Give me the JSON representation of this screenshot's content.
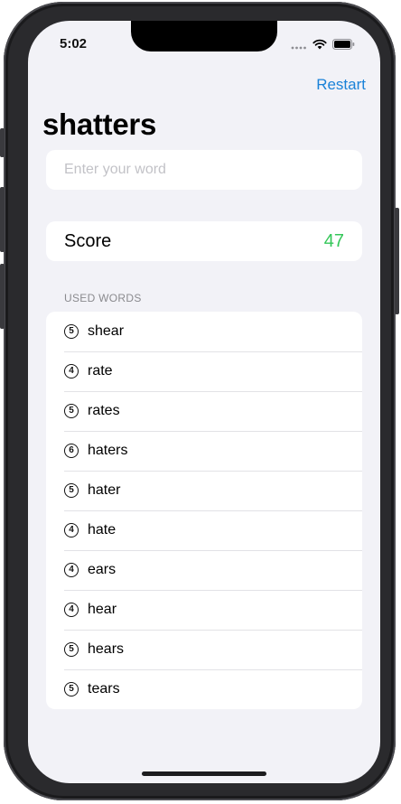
{
  "status_bar": {
    "time": "5:02"
  },
  "nav": {
    "restart_label": "Restart",
    "title": "shatters"
  },
  "input": {
    "placeholder": "Enter your word",
    "value": ""
  },
  "score": {
    "label": "Score",
    "value": "47"
  },
  "used_words": {
    "header": "USED WORDS",
    "items": [
      {
        "count": "5",
        "word": "shear"
      },
      {
        "count": "4",
        "word": "rate"
      },
      {
        "count": "5",
        "word": "rates"
      },
      {
        "count": "6",
        "word": "haters"
      },
      {
        "count": "5",
        "word": "hater"
      },
      {
        "count": "4",
        "word": "hate"
      },
      {
        "count": "4",
        "word": "ears"
      },
      {
        "count": "4",
        "word": "hear"
      },
      {
        "count": "5",
        "word": "hears"
      },
      {
        "count": "5",
        "word": "tears"
      }
    ]
  },
  "colors": {
    "accent": "#1a82d8",
    "score": "#34c759",
    "background": "#f2f2f7"
  },
  "icons": {
    "signal": "cellular-signal-icon",
    "wifi": "wifi-icon",
    "battery": "battery-icon",
    "word_count": "numbered-circle-icon"
  }
}
